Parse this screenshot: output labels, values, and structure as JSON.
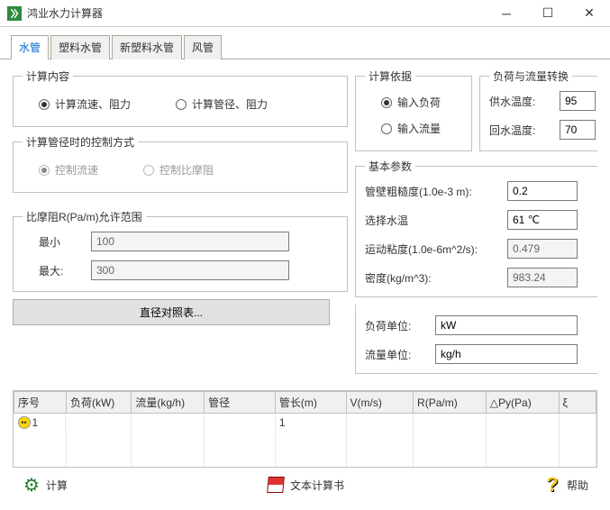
{
  "window": {
    "title": "鸿业水力计算器"
  },
  "tabs": [
    "水管",
    "塑料水管",
    "新塑料水管",
    "风管"
  ],
  "calcContent": {
    "legend": "计算内容",
    "opt1": "计算流速、阻力",
    "opt2": "计算管径、阻力"
  },
  "controlMode": {
    "legend": "计算管径时的控制方式",
    "opt1": "控制流速",
    "opt2": "控制比摩阻"
  },
  "friction": {
    "legend": "比摩阻R(Pa/m)允许范围",
    "minLabel": "最小",
    "min": "100",
    "maxLabel": "最大:",
    "max": "300"
  },
  "diameterBtn": "直径对照表...",
  "calcBasis": {
    "legend": "计算依据",
    "opt1": "输入负荷",
    "opt2": "输入流量"
  },
  "loadFlow": {
    "legend": "负荷与流量转换",
    "supplyLabel": "供水温度:",
    "supply": "95",
    "returnLabel": "回水温度:",
    "return": "70"
  },
  "basic": {
    "legend": "基本参数",
    "roughLabel": "管壁粗糙度(1.0e-3 m):",
    "rough": "0.2",
    "tempLabel": "选择水温",
    "temp": "61 ℃",
    "viscLabel": "运动粘度(1.0e-6m^2/s):",
    "visc": "0.479",
    "densLabel": "密度(kg/m^3):",
    "dens": "983.24"
  },
  "units": {
    "loadLabel": "负荷单位:",
    "load": "kW",
    "flowLabel": "流量单位:",
    "flow": "kg/h"
  },
  "table": {
    "headers": [
      "序号",
      "负荷(kW)",
      "流量(kg/h)",
      "管径",
      "管长(m)",
      "V(m/s)",
      "R(Pa/m)",
      "△Py(Pa)",
      "ξ"
    ],
    "row1": {
      "seq": "1",
      "len": "1"
    }
  },
  "footer": {
    "calc": "计算",
    "doc": "文本计算书",
    "help": "帮助"
  }
}
